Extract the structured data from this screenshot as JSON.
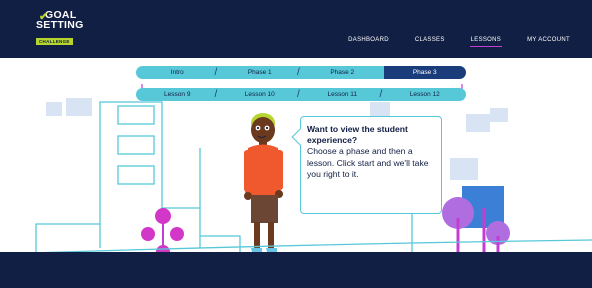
{
  "logo": {
    "line1": "GOAL",
    "line2": "SETTING",
    "tag": "CHALLENGE"
  },
  "nav": [
    {
      "label": "DASHBOARD",
      "active": false
    },
    {
      "label": "CLASSES",
      "active": false
    },
    {
      "label": "LESSONS",
      "active": true
    },
    {
      "label": "MY ACCOUNT",
      "active": false
    }
  ],
  "phases": [
    "Intro",
    "Phase 1",
    "Phase 2",
    "Phase 3"
  ],
  "active_phase": "Phase 3",
  "lessons": [
    "Lesson 9",
    "Lesson 10",
    "Lesson 11",
    "Lesson 12"
  ],
  "bubble": {
    "title": "Want to view the student experience?",
    "body": "Choose a phase and then a lesson. Click start and we'll take you right to it."
  },
  "colors": {
    "navy": "#121f44",
    "accent_green": "#b7d52f",
    "teal": "#57c8d8",
    "active_tab": "#1b3c7a",
    "magenta": "#c43dd2",
    "light_blue": "#d8e4f4"
  }
}
